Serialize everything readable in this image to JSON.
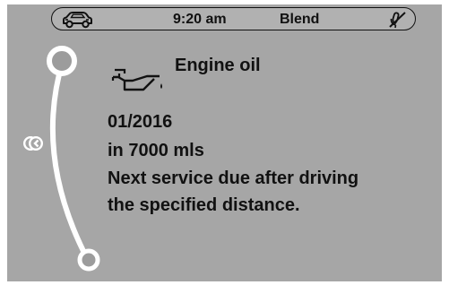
{
  "status_bar": {
    "time": "9:20  am",
    "mode": "Blend",
    "car_icon": "car-icon",
    "mute_icon": "mute-microphone-icon"
  },
  "message": {
    "icon": "oil-can-icon",
    "title": "Engine oil",
    "lines": [
      "01/2016",
      "in 7000 mls",
      "Next service due after driving",
      "the specified distance."
    ]
  },
  "navigation": {
    "back_icon": "back-arrows-icon",
    "scroll_position": 0
  },
  "colors": {
    "screen_background": "#a6a6a6",
    "text": "#111111",
    "scroll_track": "#ffffff",
    "scroll_knob": "#999999"
  }
}
